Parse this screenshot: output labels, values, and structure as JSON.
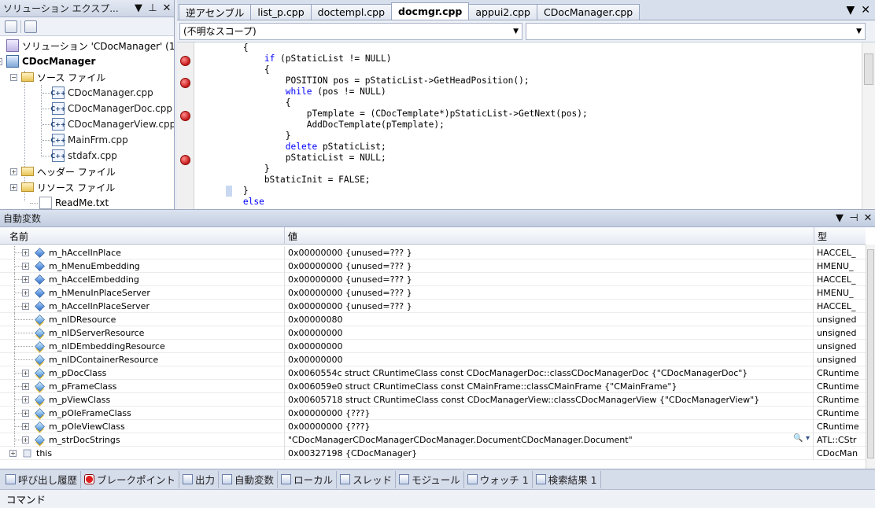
{
  "solution_explorer": {
    "title": "ソリューション エクスプ...",
    "buttons": {
      "dropdown": "▼",
      "pin": "⊥",
      "close": "✕"
    },
    "tree": [
      {
        "label": "ソリューション 'CDocManager' (1",
        "kind": "solution"
      },
      {
        "label": "CDocManager",
        "kind": "project"
      },
      {
        "label": "ソース ファイル",
        "kind": "folder"
      },
      {
        "label": "CDocManager.cpp",
        "kind": "cpp"
      },
      {
        "label": "CDocManagerDoc.cpp",
        "kind": "cpp"
      },
      {
        "label": "CDocManagerView.cpp",
        "kind": "cpp"
      },
      {
        "label": "MainFrm.cpp",
        "kind": "cpp"
      },
      {
        "label": "stdafx.cpp",
        "kind": "cpp"
      },
      {
        "label": "ヘッダー ファイル",
        "kind": "folder"
      },
      {
        "label": "リソース ファイル",
        "kind": "folder"
      },
      {
        "label": "ReadMe.txt",
        "kind": "txt"
      }
    ],
    "cpp_icon_text": "C++"
  },
  "editor": {
    "tabs": [
      "逆アセンブル",
      "list_p.cpp",
      "doctempl.cpp",
      "docmgr.cpp",
      "appui2.cpp",
      "CDocManager.cpp"
    ],
    "active_tab": "docmgr.cpp",
    "scope": "(不明なスコープ)",
    "member": "",
    "controls": {
      "dropdown": "▼",
      "close": "✕"
    },
    "code_lines": [
      "        {",
      "            if (pStaticList != NULL)",
      "            {",
      "                POSITION pos = pStaticList->GetHeadPosition();",
      "                while (pos != NULL)",
      "                {",
      "                    pTemplate = (CDocTemplate*)pStaticList->GetNext(pos);",
      "                    AddDocTemplate(pTemplate);",
      "                }",
      "                delete pStaticList;",
      "                pStaticList = NULL;",
      "            }",
      "            bStaticInit = FALSE;",
      "        }",
      "        else"
    ]
  },
  "autos": {
    "title": "自動変数",
    "buttons": {
      "dropdown": "▼",
      "float": "⊣",
      "close": "✕"
    },
    "columns": {
      "name": "名前",
      "value": "値",
      "type": "型"
    },
    "rows": [
      {
        "name": "m_hAccelInPlace",
        "value": "0x00000000 {unused=??? }",
        "type": "HACCEL_",
        "expandable": true,
        "icon": "prop",
        "indent": 1
      },
      {
        "name": "m_hMenuEmbedding",
        "value": "0x00000000 {unused=??? }",
        "type": "HMENU_",
        "expandable": true,
        "icon": "prop",
        "indent": 1
      },
      {
        "name": "m_hAccelEmbedding",
        "value": "0x00000000 {unused=??? }",
        "type": "HACCEL_",
        "expandable": true,
        "icon": "prop",
        "indent": 1
      },
      {
        "name": "m_hMenuInPlaceServer",
        "value": "0x00000000 {unused=??? }",
        "type": "HMENU_",
        "expandable": true,
        "icon": "prop",
        "indent": 1
      },
      {
        "name": "m_hAccelInPlaceServer",
        "value": "0x00000000 {unused=??? }",
        "type": "HACCEL_",
        "expandable": true,
        "icon": "prop",
        "indent": 1
      },
      {
        "name": "m_nIDResource",
        "value": "0x00000080",
        "type": "unsigned",
        "expandable": false,
        "icon": "field",
        "indent": 1
      },
      {
        "name": "m_nIDServerResource",
        "value": "0x00000000",
        "type": "unsigned",
        "expandable": false,
        "icon": "field",
        "indent": 1
      },
      {
        "name": "m_nIDEmbeddingResource",
        "value": "0x00000000",
        "type": "unsigned",
        "expandable": false,
        "icon": "field",
        "indent": 1
      },
      {
        "name": "m_nIDContainerResource",
        "value": "0x00000000",
        "type": "unsigned",
        "expandable": false,
        "icon": "field",
        "indent": 1
      },
      {
        "name": "m_pDocClass",
        "value": "0x0060554c struct CRuntimeClass const CDocManagerDoc::classCDocManagerDoc {\"CDocManagerDoc\"}",
        "type": "CRuntime",
        "expandable": true,
        "icon": "field",
        "indent": 1
      },
      {
        "name": "m_pFrameClass",
        "value": "0x006059e0 struct CRuntimeClass const CMainFrame::classCMainFrame {\"CMainFrame\"}",
        "type": "CRuntime",
        "expandable": true,
        "icon": "field",
        "indent": 1
      },
      {
        "name": "m_pViewClass",
        "value": "0x00605718 struct CRuntimeClass const CDocManagerView::classCDocManagerView {\"CDocManagerView\"}",
        "type": "CRuntime",
        "expandable": true,
        "icon": "field",
        "indent": 1
      },
      {
        "name": "m_pOleFrameClass",
        "value": "0x00000000 {???}",
        "type": "CRuntime",
        "expandable": true,
        "icon": "field",
        "indent": 1
      },
      {
        "name": "m_pOleViewClass",
        "value": "0x00000000 {???}",
        "type": "CRuntime",
        "expandable": true,
        "icon": "field",
        "indent": 1
      },
      {
        "name": "m_strDocStrings",
        "value": "\"CDocManagerCDocManagerCDocManager.DocumentCDocManager.Document\"",
        "type": "ATL::CStr",
        "expandable": true,
        "icon": "field",
        "indent": 1,
        "magnifier": "🔍 ▾"
      },
      {
        "name": "this",
        "value": "0x00327198 {CDocManager}",
        "type": "CDocMan",
        "expandable": true,
        "icon": "obj",
        "indent": 0
      }
    ]
  },
  "bottom_tabs": [
    "呼び出し履歴",
    "ブレークポイント",
    "出力",
    "自動変数",
    "ローカル",
    "スレッド",
    "モジュール",
    "ウォッチ 1",
    "検索結果 1"
  ],
  "command": "コマンド"
}
